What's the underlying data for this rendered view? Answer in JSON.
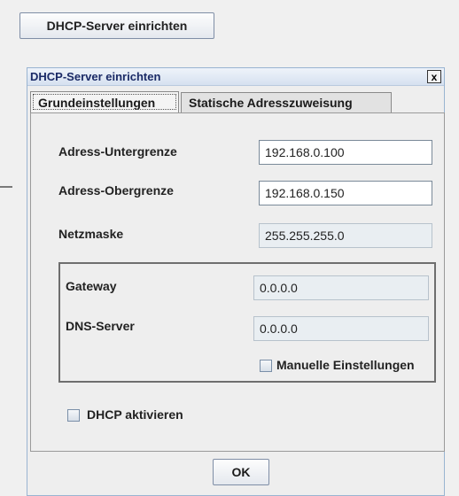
{
  "launcher": {
    "button_label": "DHCP-Server einrichten"
  },
  "dialog": {
    "title": "DHCP-Server einrichten",
    "close_label": "x",
    "tabs": [
      {
        "label": "Grundeinstellungen",
        "active": true
      },
      {
        "label": "Statische Adresszuweisung",
        "active": false
      }
    ],
    "fields": {
      "lower_label": "Adress-Untergrenze",
      "lower_value": "192.168.0.100",
      "upper_label": "Adress-Obergrenze",
      "upper_value": "192.168.0.150",
      "netmask_label": "Netzmaske",
      "netmask_value": "255.255.255.0",
      "gateway_label": "Gateway",
      "gateway_value": "0.0.0.0",
      "dns_label": "DNS-Server",
      "dns_value": "0.0.0.0"
    },
    "manual_checkbox_label": "Manuelle Einstellungen",
    "dhcp_checkbox_label": "DHCP aktivieren",
    "ok_label": "OK"
  }
}
